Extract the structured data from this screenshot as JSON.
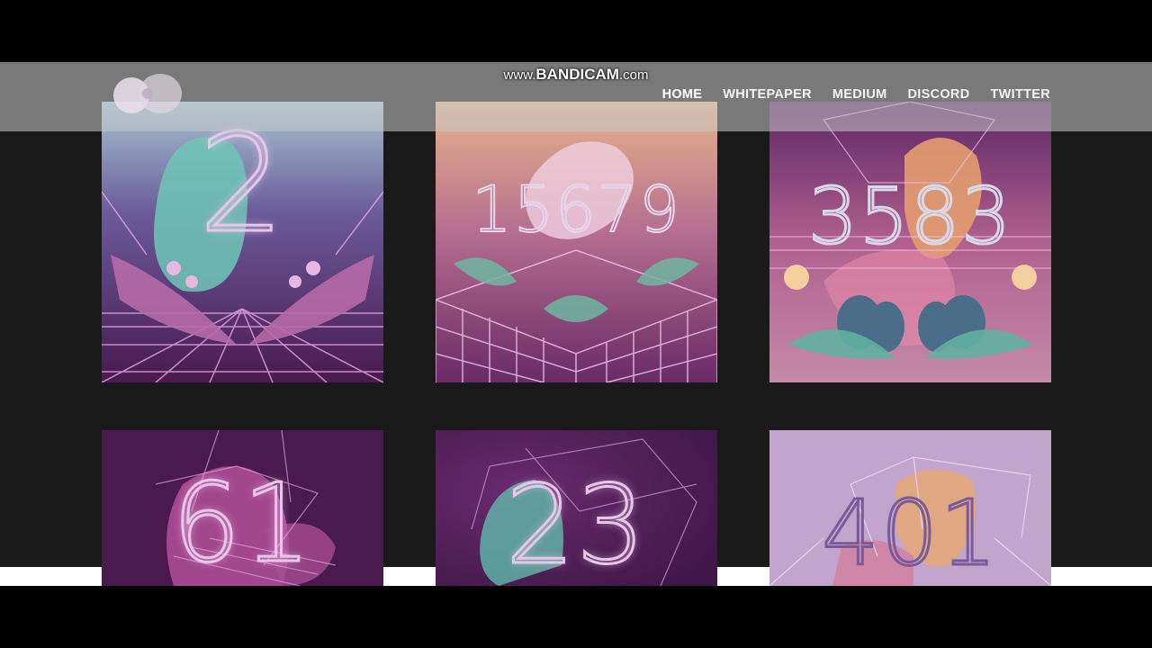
{
  "watermark": {
    "prefix": "www.",
    "brand": "BANDICAM",
    "suffix": ".com"
  },
  "nav": {
    "items": [
      {
        "label": "HOME",
        "active": true
      },
      {
        "label": "WHITEPAPER",
        "active": false
      },
      {
        "label": "MEDIUM",
        "active": false
      },
      {
        "label": "DISCORD",
        "active": false
      },
      {
        "label": "TWITTER",
        "active": false
      }
    ]
  },
  "cards": [
    {
      "number": "2"
    },
    {
      "number": "15679"
    },
    {
      "number": "3583"
    },
    {
      "number": "61"
    },
    {
      "number": "23"
    },
    {
      "number": "401"
    }
  ],
  "icons": {
    "logo": "circular-logo-icon"
  }
}
